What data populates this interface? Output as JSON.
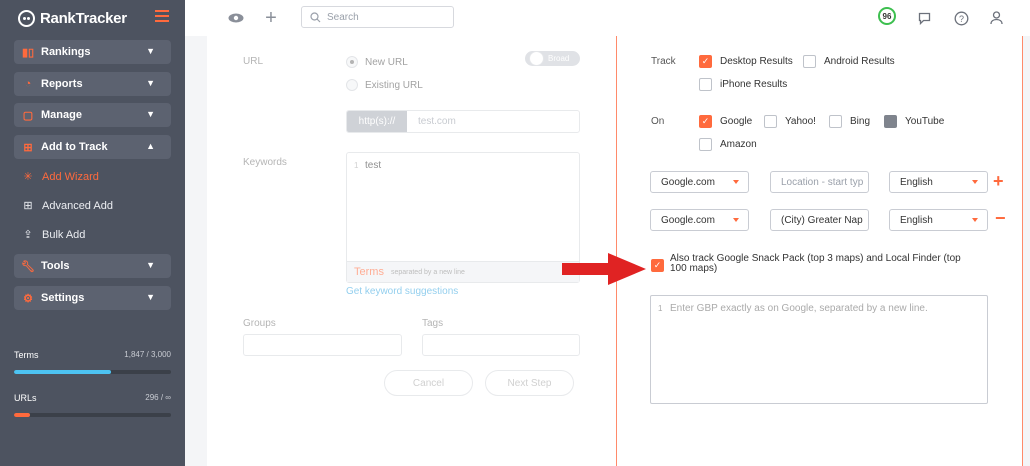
{
  "app": {
    "brand_name": "RankTracker",
    "brand_prefix": "iRank"
  },
  "sidebar": {
    "nav": [
      {
        "label": "Rankings",
        "icon": "bar-chart-icon"
      },
      {
        "label": "Reports",
        "icon": "pie-chart-icon"
      },
      {
        "label": "Manage",
        "icon": "document-gear-icon"
      },
      {
        "label": "Add to Track",
        "icon": "plus-square-icon"
      },
      {
        "label": "Tools",
        "icon": "wrench-icon"
      },
      {
        "label": "Settings",
        "icon": "gear-icon"
      }
    ],
    "sub_items": [
      {
        "label": "Add Wizard",
        "icon": "wizard-icon",
        "active": true
      },
      {
        "label": "Advanced Add",
        "icon": "add-box-icon"
      },
      {
        "label": "Bulk Add",
        "icon": "upload-icon"
      }
    ],
    "stats": {
      "terms_label": "Terms",
      "terms_value": "1,847 / 3,000",
      "terms_fraction": 0.62,
      "urls_label": "URLs",
      "urls_value": "296 / ∞",
      "urls_fraction": 0.1
    },
    "colors": {
      "accent": "#ff6a3d",
      "terms_bar": "#4dc3f2",
      "urls_bar": "#ff6a3d"
    }
  },
  "topbar": {
    "search_placeholder": "Search",
    "score": "96"
  },
  "left_form": {
    "url_label": "URL",
    "new_url": "New URL",
    "existing_url": "Existing URL",
    "broad_toggle": "Broad",
    "url_prefix": "http(s)://",
    "url_value": "test.com",
    "keywords_label": "Keywords",
    "keyword_line_no": "1",
    "keyword_value": "test",
    "terms_label": "Terms",
    "terms_hint": "separated by a new line",
    "suggest_link": "Get keyword suggestions",
    "groups_label": "Groups",
    "tags_label": "Tags",
    "cancel_label": "Cancel",
    "next_label": "Next Step"
  },
  "right_form": {
    "track_label": "Track",
    "desktop": "Desktop Results",
    "android": "Android Results",
    "iphone": "iPhone Results",
    "on_label": "On",
    "google": "Google",
    "yahoo": "Yahoo!",
    "bing": "Bing",
    "youtube": "YouTube",
    "amazon": "Amazon",
    "row1": {
      "engine": "Google.com",
      "location_placeholder": "Location - start typ",
      "language": "English"
    },
    "row2": {
      "engine": "Google.com",
      "location": "(City) Greater Nap",
      "language": "English"
    },
    "plus": "+",
    "minus": "−",
    "snack_pack": "Also track Google Snack Pack (top 3 maps) and Local Finder (top 100 maps)",
    "gbp_line_no": "1",
    "gbp_placeholder": "Enter GBP exactly as on Google, separated by a new line."
  }
}
